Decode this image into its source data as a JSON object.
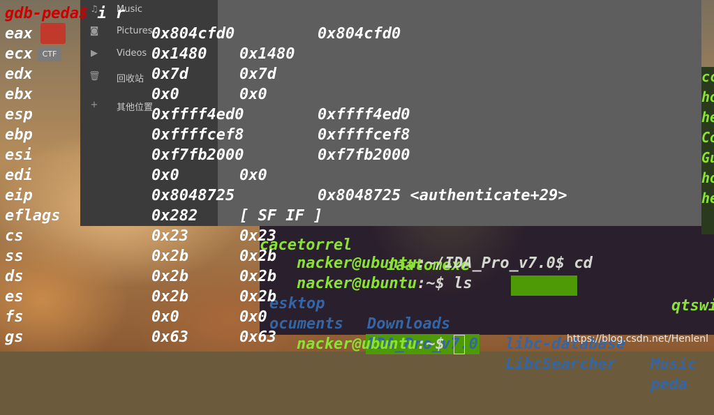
{
  "file_manager": {
    "items": [
      {
        "icon": "music-note-icon",
        "label": "Music"
      },
      {
        "icon": "camera-icon",
        "label": "Pictures"
      },
      {
        "icon": "video-camera-icon",
        "label": "Videos"
      },
      {
        "icon": "trash-icon",
        "label": "回收站"
      },
      {
        "icon": "plus-icon",
        "label": "其他位置"
      }
    ]
  },
  "desktop": {
    "ctf_label": "CTF"
  },
  "background_terminal": {
    "line1_a": "nacker@ubuntu",
    "line1_b": ":~/IDA_Pro_v7.0$ cd",
    "line2_a": "nacker@ubuntu",
    "line2_b": ":~$ ls",
    "listing_row1": [
      "esktop",
      "Downloads",
      "libc-database",
      "Music"
    ],
    "listing_row2": [
      "ocuments",
      "IDA_Pro_v7.0",
      "LibcSearcher",
      "peda"
    ],
    "line3_a": "nacker@ubuntu",
    "line3_b": ":~$ ",
    "partial_top_a": "cacetorrel",
    "partial_top_b": "iaatomexe",
    "partial_top_c": "qtswi",
    "right_strip": [
      "cc",
      "ho",
      "he",
      "Co",
      "Gu",
      "ho",
      "he"
    ]
  },
  "gdb": {
    "prompt": "gdb-peda$",
    "command": " i r",
    "registers": [
      {
        "name": "eax",
        "hex": "0x804cfd0",
        "value": "0x804cfd0"
      },
      {
        "name": "ecx",
        "hex": "0x1480",
        "value": "0x1480"
      },
      {
        "name": "edx",
        "hex": "0x7d",
        "value": "0x7d"
      },
      {
        "name": "ebx",
        "hex": "0x0",
        "value": "0x0"
      },
      {
        "name": "esp",
        "hex": "0xffff4ed0",
        "value": "0xffff4ed0"
      },
      {
        "name": "ebp",
        "hex": "0xffffcef8",
        "value": "0xffffcef8"
      },
      {
        "name": "esi",
        "hex": "0xf7fb2000",
        "value": "0xf7fb2000"
      },
      {
        "name": "edi",
        "hex": "0x0",
        "value": "0x0"
      },
      {
        "name": "eip",
        "hex": "0x8048725",
        "value": "0x8048725 <authenticate+29>"
      },
      {
        "name": "eflags",
        "hex": "0x282",
        "value": "[ SF IF ]"
      },
      {
        "name": "cs",
        "hex": "0x23",
        "value": "0x23"
      },
      {
        "name": "ss",
        "hex": "0x2b",
        "value": "0x2b"
      },
      {
        "name": "ds",
        "hex": "0x2b",
        "value": "0x2b"
      },
      {
        "name": "es",
        "hex": "0x2b",
        "value": "0x2b"
      },
      {
        "name": "fs",
        "hex": "0x0",
        "value": "0x0"
      },
      {
        "name": "gs",
        "hex": "0x63",
        "value": "0x63"
      }
    ]
  },
  "watermark": "https://blog.csdn.net/Henlenl"
}
